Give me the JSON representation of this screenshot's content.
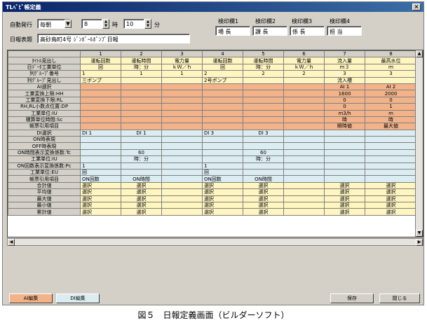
{
  "window": {
    "title": "TLﾍﾞﾋﾞ帳定義",
    "close_label": "×"
  },
  "top": {
    "auto_print_label": "自動発行",
    "auto_print_value": "毎朝",
    "hour_value": "8",
    "hour_unit": "時",
    "minute_value": "10",
    "minute_unit": "分",
    "report_name_label": "日報表題",
    "report_name_value": "高砂鳥町4号 ｼﾞﾝﾎﾞｰﾙﾎﾟﾝﾌﾟ日報"
  },
  "stamps": [
    {
      "header": "検印欄1",
      "value": "場 長"
    },
    {
      "header": "検印欄2",
      "value": "課 長"
    },
    {
      "header": "検印欄3",
      "value": "係 長"
    },
    {
      "header": "検印欄4",
      "value": "担 当"
    }
  ],
  "grid": {
    "columns": [
      "1",
      "2",
      "3",
      "4",
      "5",
      "6",
      "7",
      "8"
    ],
    "rows": [
      {
        "label": "ﾀｲﾄﾙ見出し",
        "cls": "y",
        "cells": [
          "運転回数",
          "運転時間",
          "電力量",
          "運転回数",
          "運転時間",
          "電力量",
          "流入量",
          "最高水位"
        ]
      },
      {
        "label": "日ﾃﾞｰﾀ工業単位",
        "cls": "y",
        "cells": [
          "回",
          "時：分",
          "ｋＷ／ｈ",
          "回",
          "時：分",
          "ｋＷ／ｈ",
          "ｍ３",
          "ｍ"
        ]
      },
      {
        "label": "列ｸﾞﾙｰﾌﾟ番号",
        "cls": "y",
        "cells": [
          "1",
          "1",
          "1",
          "2",
          "2",
          "2",
          "3",
          "3"
        ]
      },
      {
        "label": "列ｸﾞﾙｰﾌﾟ見出し",
        "cls": "y",
        "cells": [
          "三ポンプ",
          "",
          "",
          "2号ポンプ",
          "",
          "",
          "流入槽",
          ""
        ]
      },
      {
        "label": "AI選択",
        "cls": "o",
        "cells": [
          "",
          "",
          "",
          "",
          "",
          "",
          "AI 1",
          "AI 2"
        ]
      },
      {
        "label": "工業変換上限:HH",
        "cls": "o",
        "cells": [
          "",
          "",
          "",
          "",
          "",
          "",
          "1600",
          "2000"
        ]
      },
      {
        "label": "工業変換下限:RL",
        "cls": "o",
        "cells": [
          "",
          "",
          "",
          "",
          "",
          "",
          "0",
          "0"
        ]
      },
      {
        "label": "RH,RL小数点位置:DP",
        "cls": "o",
        "cells": [
          "",
          "",
          "",
          "",
          "",
          "",
          "0",
          "1"
        ]
      },
      {
        "label": "工業単位:IU",
        "cls": "o",
        "cells": [
          "",
          "",
          "",
          "",
          "",
          "",
          "m3/h",
          "m"
        ]
      },
      {
        "label": "積算単位時間:Sc",
        "cls": "o",
        "cells": [
          "",
          "",
          "",
          "",
          "",
          "",
          "時",
          "時"
        ]
      },
      {
        "label": "帳票引用項目",
        "cls": "o",
        "cells": [
          "",
          "",
          "",
          "",
          "",
          "",
          "瞬時値",
          "最大値"
        ]
      },
      {
        "label": "DI選択",
        "cls": "b",
        "cells": [
          "DI 1",
          "DI 1",
          "",
          "DI 3",
          "DI 3",
          "",
          "",
          ""
        ]
      },
      {
        "label": "ON時表現",
        "cls": "b",
        "cells": [
          "",
          "",
          "",
          "",
          "",
          "",
          "",
          ""
        ]
      },
      {
        "label": "OFF時表現",
        "cls": "b",
        "cells": [
          "",
          "",
          "",
          "",
          "",
          "",
          "",
          ""
        ]
      },
      {
        "label": "ON時間表示変換係数:Tc",
        "cls": "b",
        "cells": [
          "",
          "60",
          "",
          "",
          "60",
          "",
          "",
          ""
        ]
      },
      {
        "label": "工業単位:IU",
        "cls": "b",
        "cells": [
          "",
          "時：分",
          "",
          "",
          "時：分",
          "",
          "",
          ""
        ]
      },
      {
        "label": "ON回数表示変換係数:Pc",
        "cls": "b",
        "cells": [
          "1",
          "",
          "",
          "1",
          "",
          "",
          "",
          ""
        ]
      },
      {
        "label": "工業単位:EU",
        "cls": "b",
        "cells": [
          "回",
          "",
          "",
          "回",
          "",
          "",
          "",
          ""
        ]
      },
      {
        "label": "帳票引用項目",
        "cls": "b",
        "cells": [
          "ON回数",
          "ON時間",
          "",
          "ON回数",
          "ON時間",
          "",
          "",
          ""
        ]
      },
      {
        "label": "合計値",
        "cls": "y",
        "cells": [
          "選択",
          "選択",
          "",
          "選択",
          "選択",
          "",
          "選択",
          "選択"
        ]
      },
      {
        "label": "平均値",
        "cls": "y",
        "cells": [
          "選択",
          "選択",
          "",
          "選択",
          "選択",
          "",
          "選択",
          "選択"
        ]
      },
      {
        "label": "最大値",
        "cls": "y",
        "cells": [
          "選択",
          "選択",
          "",
          "選択",
          "選択",
          "",
          "選択",
          "選択"
        ]
      },
      {
        "label": "最小値",
        "cls": "y",
        "cells": [
          "選択",
          "選択",
          "",
          "選択",
          "選択",
          "",
          "選択",
          "選択"
        ]
      },
      {
        "label": "累計値",
        "cls": "y",
        "cells": [
          "選択",
          "選択",
          "",
          "選択",
          "選択",
          "",
          "選択",
          "選択"
        ]
      }
    ]
  },
  "footer": {
    "tab_ai": "AI編集",
    "tab_di": "DI編集",
    "save_label": "保存",
    "close_label": "閉じる"
  },
  "caption": "図５　日報定義画面（ビルダーソフト）",
  "colors": {
    "yellow_row": "#fff5c0",
    "orange_row": "#f2b38a",
    "blue_row": "#dcedf2",
    "titlebar": "#0a246a"
  }
}
